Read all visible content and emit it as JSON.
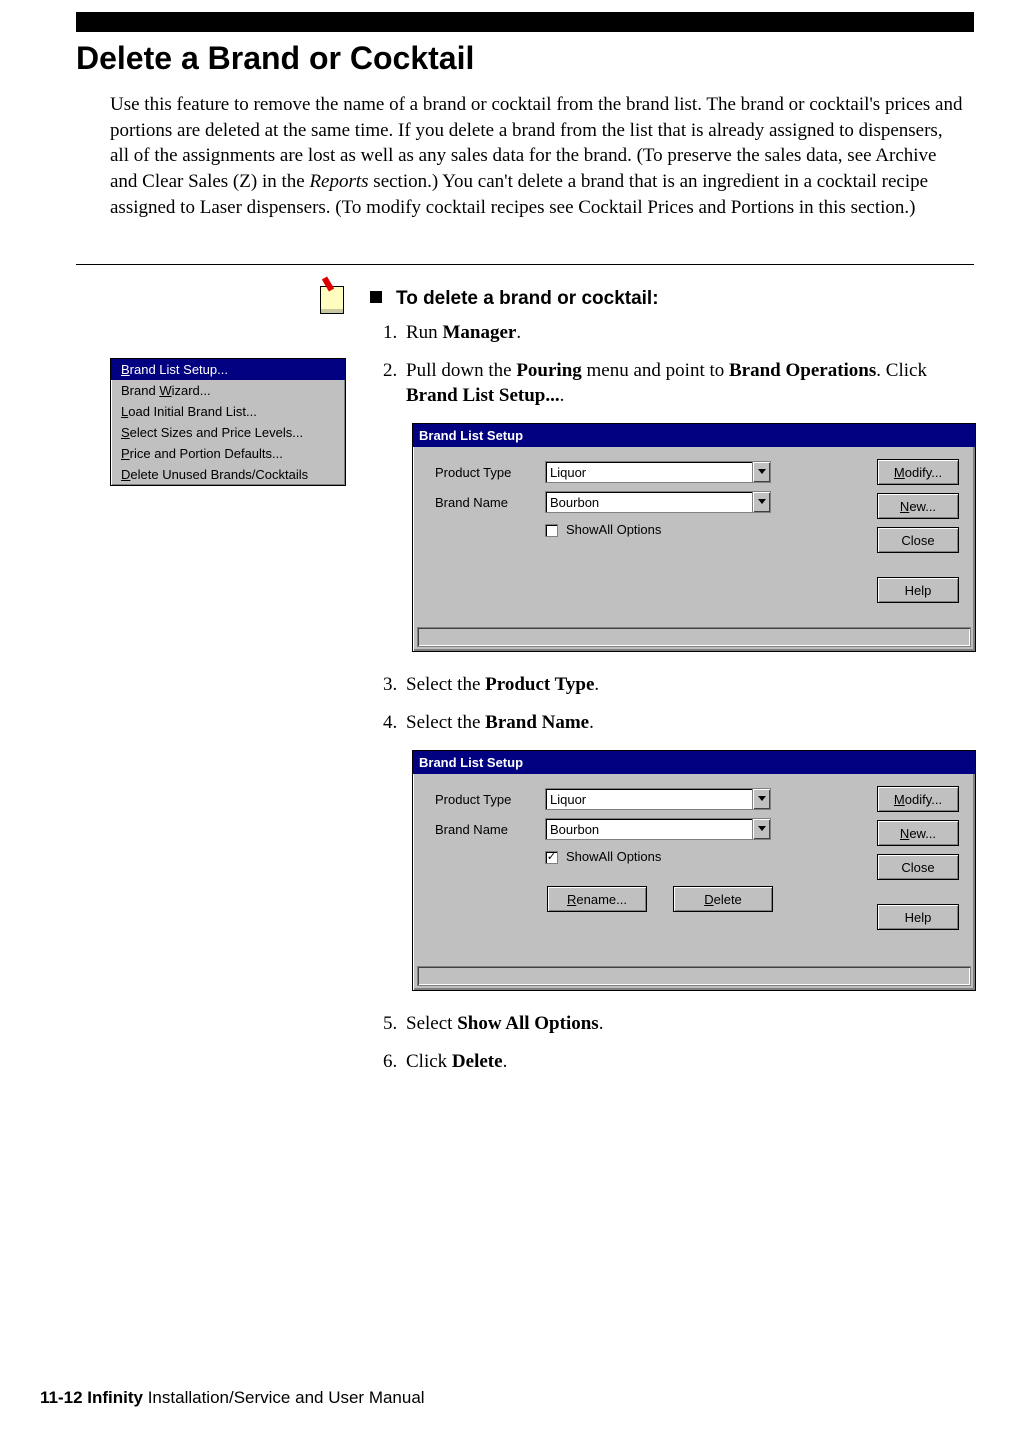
{
  "heading": "Delete a Brand or Cocktail",
  "intro_1": "Use this feature to remove the name of a brand or cocktail from the brand list. The brand or cocktail's prices and portions are deleted at the same time. If you delete a brand from the list that is already assigned to dispensers, all of the assignments are lost as well as any sales data for the brand. (To preserve the sales data, see Archive and Clear Sales (Z) in the ",
  "intro_ital": "Reports",
  "intro_2": " section.) You can't delete a brand that is an ingredient in a cocktail recipe assigned to Laser dispensers. (To modify cocktail recipes see Cocktail Prices and Portions in this section.)",
  "proc_title": "To delete a brand or cocktail:",
  "step1_a": "Run ",
  "step1_b": "Manager",
  "step1_c": ".",
  "step2_a": "Pull down the ",
  "step2_b": "Pouring",
  "step2_c": " menu and point to ",
  "step2_d": "Brand Operations",
  "step2_e": ". Click ",
  "step2_f": "Brand List Setup...",
  "step2_g": ".",
  "step3_a": "Select the ",
  "step3_b": "Product Type",
  "step3_c": ".",
  "step4_a": "Select the ",
  "step4_b": "Brand Name",
  "step4_c": ".",
  "step5_a": "Select ",
  "step5_b": "Show All Options",
  "step5_c": ".",
  "step6_a": "Click ",
  "step6_b": "Delete",
  "step6_c": ".",
  "menu": {
    "i0_pre": "B",
    "i0_rest": "rand List Setup...",
    "i1_pre": "Brand ",
    "i1_u": "W",
    "i1_rest": "izard...",
    "i2_u": "L",
    "i2_rest": "oad Initial Brand List...",
    "i3_u": "S",
    "i3_rest": "elect Sizes and Price Levels...",
    "i4_u": "P",
    "i4_rest": "rice and Portion Defaults...",
    "i5_u": "D",
    "i5_rest": "elete Unused Brands/Cocktails"
  },
  "dlg": {
    "title": "Brand List Setup",
    "lbl_product": "Product Type",
    "lbl_brand": "Brand Name",
    "val_product": "Liquor",
    "val_brand": "Bourbon",
    "show_all_pre": "Show ",
    "show_all_u": "A",
    "show_all_rest": "ll Options",
    "btn_modify_u": "M",
    "btn_modify_rest": "odify...",
    "btn_new_u": "N",
    "btn_new_rest": "ew...",
    "btn_close": "Close",
    "btn_help": "Help",
    "btn_rename_u": "R",
    "btn_rename_rest": "ename...",
    "btn_delete_u": "D",
    "btn_delete_rest": "elete"
  },
  "footer_page": "11-12  ",
  "footer_bold": "Infinity",
  "footer_rest": " Installation/Service and User Manual"
}
